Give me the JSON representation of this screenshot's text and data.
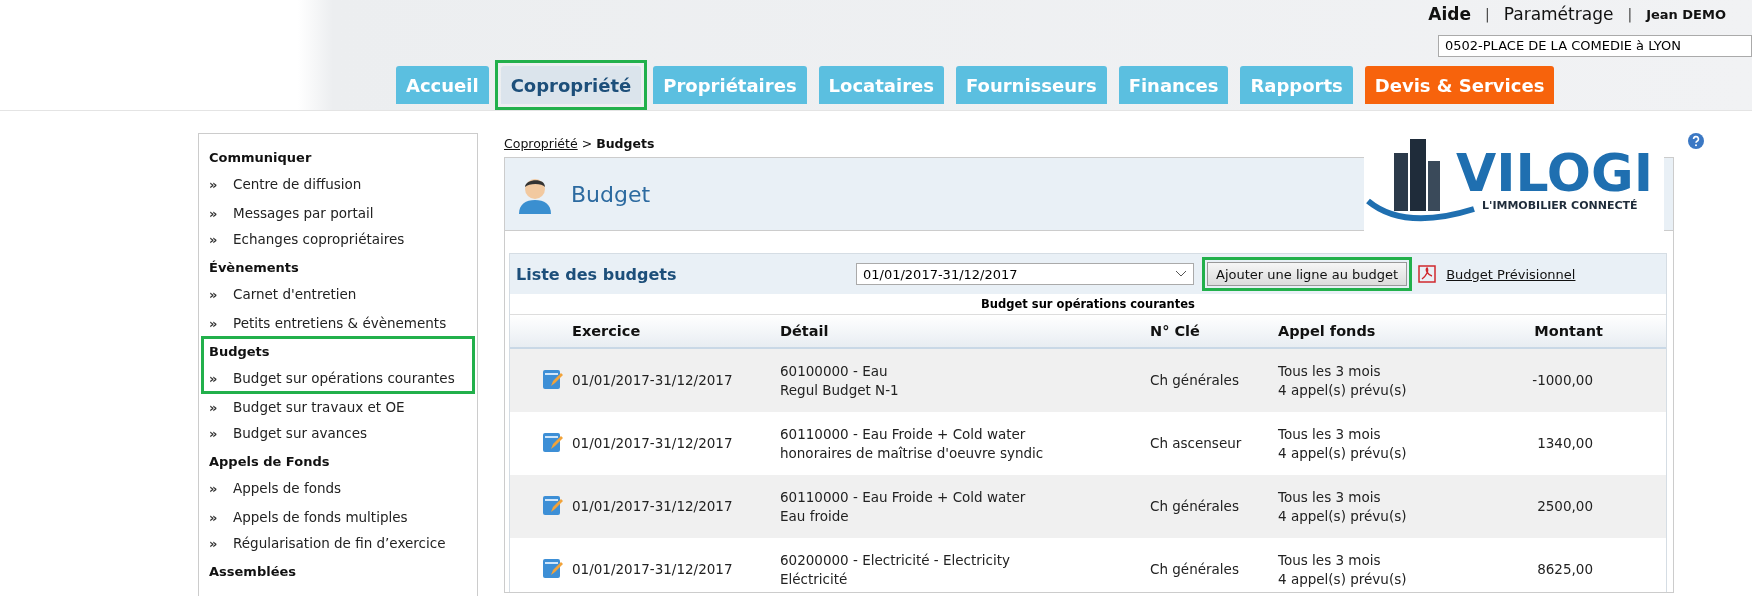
{
  "top_links": [
    {
      "label": "Aide",
      "kind": "strong"
    },
    {
      "label": "|",
      "kind": "separator"
    },
    {
      "label": "Paramétrage",
      "kind": "normal"
    },
    {
      "label": "|",
      "kind": "separator"
    },
    {
      "label": "Jean DEMO",
      "kind": "user"
    }
  ],
  "site_select": {
    "value": "0502-PLACE DE LA COMEDIE à LYON"
  },
  "tabs": [
    {
      "label": "Accueil",
      "selected": false,
      "kind": "normal"
    },
    {
      "label": "Copropriété",
      "selected": true,
      "kind": "normal"
    },
    {
      "label": "Propriétaires",
      "selected": false,
      "kind": "normal"
    },
    {
      "label": "Locataires",
      "selected": false,
      "kind": "normal"
    },
    {
      "label": "Fournisseurs",
      "selected": false,
      "kind": "normal"
    },
    {
      "label": "Finances",
      "selected": false,
      "kind": "normal"
    },
    {
      "label": "Rapports",
      "selected": false,
      "kind": "normal"
    },
    {
      "label": "Devis & Services",
      "selected": false,
      "kind": "accent"
    }
  ],
  "sidebar": {
    "sections": [
      {
        "title": "Communiquer",
        "highlighted": false,
        "items": [
          {
            "bullet": "»",
            "label": "Centre de diffusion"
          },
          {
            "bullet": "»",
            "label": "Messages par portail"
          },
          {
            "bullet": "»",
            "label": "Echanges copropriétaires"
          }
        ]
      },
      {
        "title": "Évènements",
        "highlighted": false,
        "items": [
          {
            "bullet": "»",
            "label": "Carnet d'entretien"
          },
          {
            "bullet": "»",
            "label": "Petits entretiens & évènements"
          }
        ]
      },
      {
        "title": "Budgets",
        "highlighted": true,
        "items": [
          {
            "bullet": "»",
            "label": "Budget sur opérations courantes"
          },
          {
            "bullet": "»",
            "label": "Budget sur travaux et OE"
          },
          {
            "bullet": "»",
            "label": "Budget sur avances"
          }
        ]
      },
      {
        "title": "Appels de Fonds",
        "highlighted": false,
        "items": [
          {
            "bullet": "»",
            "label": "Appels de fonds"
          },
          {
            "bullet": "»",
            "label": "Appels de fonds multiples"
          },
          {
            "bullet": "»",
            "label": "Régularisation de fin d’exercice"
          }
        ]
      },
      {
        "title": "Assemblées",
        "highlighted": false
      }
    ]
  },
  "breadcrumb": {
    "link": "Copropriété",
    "separator": ">",
    "current": "Budgets"
  },
  "logo": {
    "name": "VILOGI",
    "tagline": "L'IMMOBILIER CONNECTÉ"
  },
  "panel": {
    "title": "Budget"
  },
  "list": {
    "title": "Liste des budgets",
    "period_select": "01/01/2017-31/12/2017",
    "add_button": {
      "label": "Ajouter une ligne au budget",
      "highlighted": true
    },
    "pdf_link": "Budget Prévisionnel",
    "subtitle": "Budget sur opérations courantes"
  },
  "table": {
    "columns": [
      "Exercice",
      "Détail",
      "N° Clé",
      "Appel fonds",
      "Montant"
    ],
    "rows": [
      {
        "exercice": "01/01/2017-31/12/2017",
        "detail": [
          "60100000 - Eau",
          "Regul Budget N-1"
        ],
        "cle": "Ch générales",
        "appel": [
          "Tous les 3 mois",
          "4 appel(s) prévu(s)"
        ],
        "montant": "-1000,00"
      },
      {
        "exercice": "01/01/2017-31/12/2017",
        "detail": [
          "60110000 - Eau Froide + Cold water",
          "honoraires de maîtrise d'oeuvre syndic"
        ],
        "cle": "Ch ascenseur",
        "appel": [
          "Tous les 3 mois",
          "4 appel(s) prévu(s)"
        ],
        "montant": "1340,00"
      },
      {
        "exercice": "01/01/2017-31/12/2017",
        "detail": [
          "60110000 - Eau Froide + Cold water",
          "Eau froide"
        ],
        "cle": "Ch générales",
        "appel": [
          "Tous les 3 mois",
          "4 appel(s) prévu(s)"
        ],
        "montant": "2500,00"
      },
      {
        "exercice": "01/01/2017-31/12/2017",
        "detail": [
          "60200000 - Electricité - Electricity",
          "Eléctricité"
        ],
        "cle": "Ch générales",
        "appel": [
          "Tous les 3 mois",
          "4 appel(s) prévu(s)"
        ],
        "montant": "8625,00"
      }
    ]
  }
}
